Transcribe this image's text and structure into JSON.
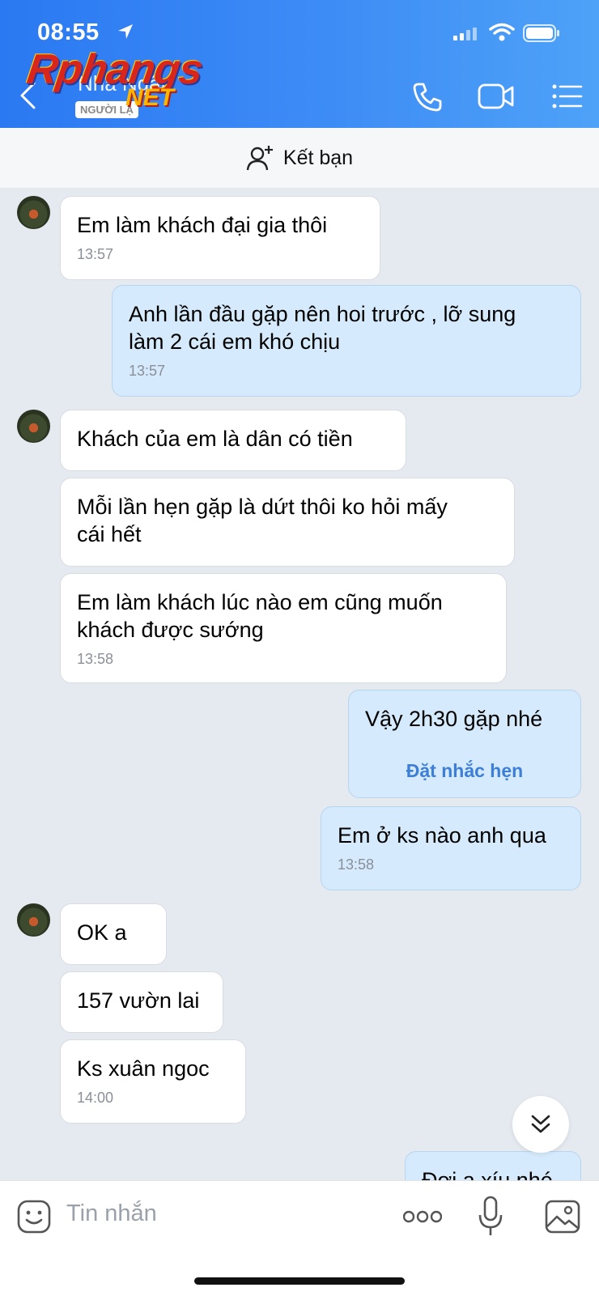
{
  "status_bar": {
    "time": "08:55"
  },
  "header": {
    "name": "Nhã Ngân",
    "badge": "NGƯỜI LẠ",
    "watermark": "Rphangs",
    "watermark_sub": "NET"
  },
  "friend_bar": {
    "label": "Kết bạn"
  },
  "messages": [
    {
      "dir": "in",
      "text": "Em làm khách đại gia thôi",
      "time": "13:57"
    },
    {
      "dir": "out",
      "text_lines": [
        "Anh lần đầu gặp nên hoi trước , lỡ sung",
        "làm 2 cái em khó chịu"
      ],
      "time": "13:57"
    },
    {
      "dir": "in",
      "text": "Khách của em là dân có tiền"
    },
    {
      "dir": "in",
      "text_lines": [
        "Mỗi lần hẹn gặp là dứt thôi ko hỏi mấy",
        "cái hết"
      ]
    },
    {
      "dir": "in",
      "text_lines": [
        "Em làm khách lúc nào em cũng muốn",
        "khách được sướng"
      ],
      "time": "13:58"
    },
    {
      "dir": "out",
      "text": "Vậy 2h30 gặp nhé",
      "reminder": "Đặt nhắc hẹn"
    },
    {
      "dir": "out",
      "text": "Em ở ks nào anh qua",
      "time": "13:58"
    },
    {
      "dir": "in",
      "text": "OK a"
    },
    {
      "dir": "in",
      "text": "157 vườn lai"
    },
    {
      "dir": "in",
      "text": "Ks xuân ngoc",
      "time": "14:00"
    },
    {
      "dir": "out",
      "text": "Đợi a xíu nhé"
    }
  ],
  "input_bar": {
    "placeholder": "Tin nhắn",
    "more_label": "ooo"
  },
  "icons": [
    "back-icon",
    "phone-icon",
    "video-icon",
    "menu-icon",
    "add-friend-icon",
    "scroll-down-icon",
    "sticker-icon",
    "microphone-icon",
    "image-icon"
  ],
  "colors": {
    "header": "#3d8cf6",
    "outgoing_bubble": "#d5eafc",
    "incoming_bubble": "#ffffff",
    "background": "#e5e9f0",
    "reminder": "#3d7fd6"
  }
}
